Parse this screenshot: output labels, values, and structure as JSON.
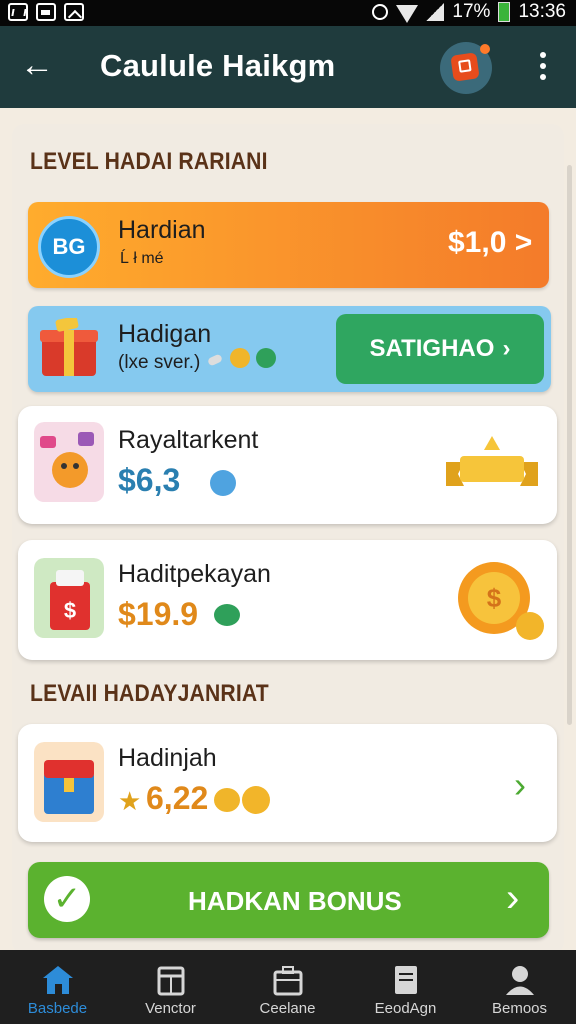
{
  "status_bar": {
    "battery": "17%",
    "time": "13:36"
  },
  "app_bar": {
    "title": "Caulule Haikgm"
  },
  "sections": [
    {
      "title": "LEVEL HADAI RARIANI"
    },
    {
      "title": "LEVAII HADAYJANRIAT"
    }
  ],
  "cards": {
    "orange": {
      "badge": "BG",
      "name": "Hardian",
      "sub": "Ĺ ł mé",
      "price": "$1,0 >"
    },
    "blue": {
      "name": "Hadigan",
      "sub": "(lxe sver.)",
      "button": "SATIGHAO"
    },
    "royal": {
      "name": "Rayaltarkent",
      "price": "$6,3"
    },
    "hadit": {
      "name": "Haditpekayan",
      "price": "$19.9",
      "badge": "$"
    },
    "hadinjah": {
      "name": "Hadinjah",
      "price": "6,22"
    }
  },
  "bonus_button": {
    "label": "HADKAN BONUS"
  },
  "bottom_nav": [
    {
      "label": "Basbede",
      "icon": "home-icon",
      "active": true
    },
    {
      "label": "Venctor",
      "icon": "calendar-icon",
      "active": false
    },
    {
      "label": "Ceelane",
      "icon": "briefcase-icon",
      "active": false
    },
    {
      "label": "EeodAgn",
      "icon": "document-icon",
      "active": false
    },
    {
      "label": "Bemoos",
      "icon": "person-icon",
      "active": false
    }
  ],
  "colors": {
    "appbar": "#1f3b3d",
    "orange": "#f47b2a",
    "blue": "#85c9ef",
    "green": "#2fa660",
    "bonus": "#5bb22f"
  }
}
